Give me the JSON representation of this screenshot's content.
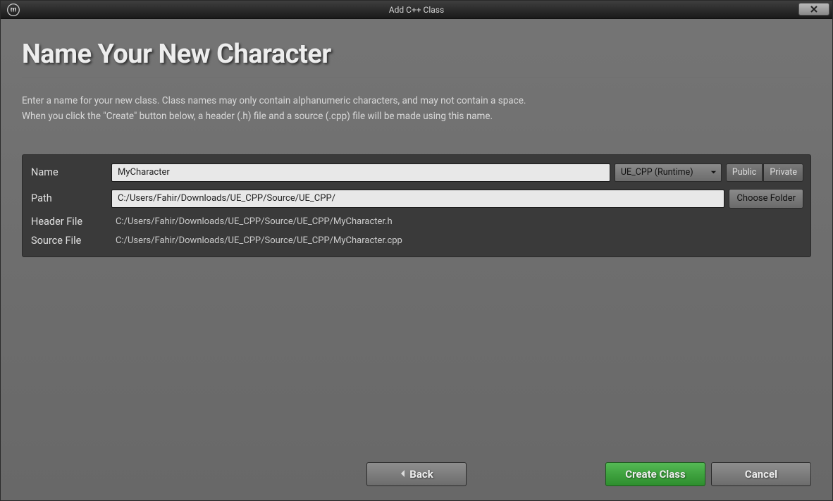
{
  "titlebar": {
    "title": "Add C++ Class"
  },
  "page": {
    "title": "Name Your New Character",
    "description_line1": "Enter a name for your new class. Class names may only contain alphanumeric characters, and may not contain a space.",
    "description_line2": "When you click the \"Create\" button below, a header (.h) file and a source (.cpp) file will be made using this name."
  },
  "form": {
    "name_label": "Name",
    "name_value": "MyCharacter",
    "module_label": "UE_CPP (Runtime)",
    "public_label": "Public",
    "private_label": "Private",
    "path_label": "Path",
    "path_value": "C:/Users/Fahir/Downloads/UE_CPP/Source/UE_CPP/",
    "choose_folder_label": "Choose Folder",
    "header_label": "Header File",
    "header_value": "C:/Users/Fahir/Downloads/UE_CPP/Source/UE_CPP/MyCharacter.h",
    "source_label": "Source File",
    "source_value": "C:/Users/Fahir/Downloads/UE_CPP/Source/UE_CPP/MyCharacter.cpp"
  },
  "footer": {
    "back_label": "Back",
    "create_label": "Create Class",
    "cancel_label": "Cancel"
  }
}
